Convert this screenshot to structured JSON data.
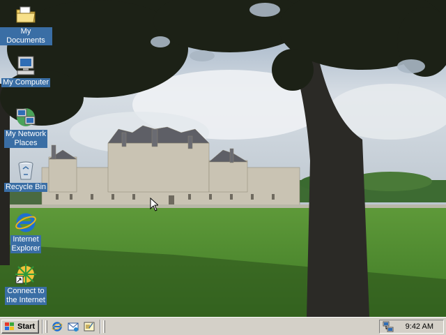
{
  "desktop": {
    "icons": [
      {
        "label": "My Documents",
        "icon": "folder-documents-icon"
      },
      {
        "label": "My Computer",
        "icon": "computer-icon"
      },
      {
        "label": "My Network\nPlaces",
        "icon": "network-places-icon"
      },
      {
        "label": "Recycle Bin",
        "icon": "recycle-bin-icon"
      },
      {
        "label": "Internet\nExplorer",
        "icon": "internet-explorer-icon"
      },
      {
        "label": "Connect to\nthe Internet",
        "icon": "connect-wizard-icon"
      }
    ],
    "wallpaper": "chateau-chambord"
  },
  "taskbar": {
    "start_label": "Start",
    "quick_launch": [
      {
        "icon": "internet-explorer-icon"
      },
      {
        "icon": "outlook-express-icon"
      },
      {
        "icon": "show-desktop-icon"
      }
    ],
    "tray": {
      "clock": "9:42 AM",
      "icons": [
        "network-connection-icon"
      ]
    }
  },
  "colors": {
    "taskbar": "#d4d0c8",
    "icon_label_bg": "#3a6ea5",
    "sky": "#c9d3dd",
    "grass": "#4f8a2f"
  }
}
